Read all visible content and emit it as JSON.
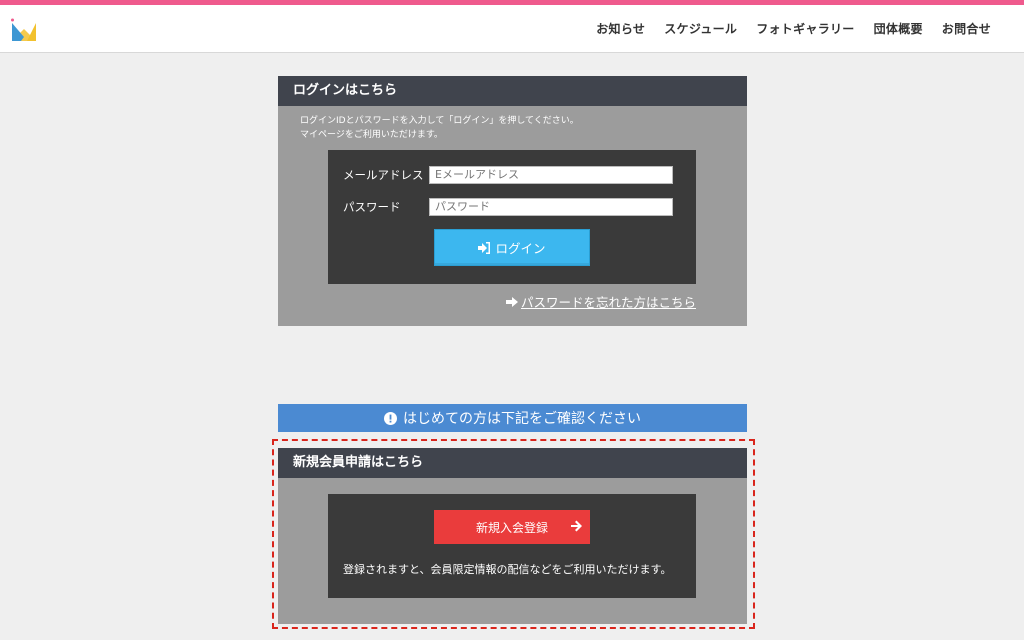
{
  "nav": {
    "items": [
      "お知らせ",
      "スケジュール",
      "フォトギャラリー",
      "団体概要",
      "お問合せ"
    ]
  },
  "login": {
    "heading": "ログインはこちら",
    "description_line1": "ログインIDとパスワードを入力して「ログイン」を押してください。",
    "description_line2": "マイページをご利用いただけます。",
    "email_label": "メールアドレス",
    "email_placeholder": "Eメールアドレス",
    "password_label": "パスワード",
    "password_placeholder": "パスワード",
    "login_button": "ログイン",
    "forgot_link": "パスワードを忘れた方はこちら"
  },
  "notice": {
    "text": "はじめての方は下記をご確認ください"
  },
  "register": {
    "heading": "新規会員申請はこちら",
    "button": "新規入会登録",
    "description": "登録されますと、会員限定情報の配信などをご利用いただけます。"
  },
  "colors": {
    "accent_pink": "#ef5a8d",
    "login_button": "#3cb7ef",
    "register_button": "#ea3c3c",
    "notice_blue": "#4b8ad2",
    "panel_head": "#40444d",
    "highlight_dashed": "#d9251c"
  }
}
